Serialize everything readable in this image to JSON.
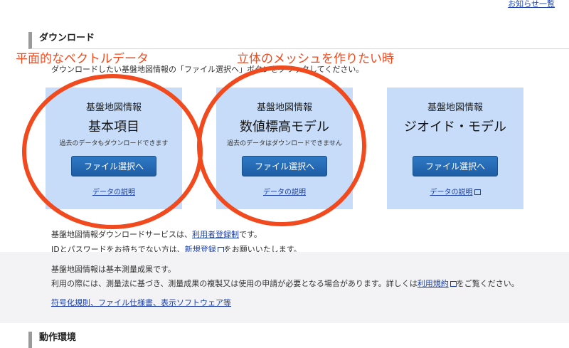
{
  "header": {
    "news_link": "お知らせ一覧"
  },
  "download_section": {
    "heading": "ダウンロード",
    "intro": "ダウンロードしたい基盤地図情報の「ファイル選択へ」ボタンをクリックしてください。"
  },
  "cards": [
    {
      "kind": "基盤地図情報",
      "title": "基本項目",
      "note": "過去のデータもダウンロードできます",
      "button": "ファイル選択へ",
      "doc_link": "データの説明"
    },
    {
      "kind": "基盤地図情報",
      "title": "数値標高モデル",
      "note": "過去のデータはダウンロードできません",
      "button": "ファイル選択へ",
      "doc_link": "データの説明"
    },
    {
      "kind": "基盤地図情報",
      "title": "ジオイド・モデル",
      "note": "",
      "button": "ファイル選択へ",
      "doc_link": "データの説明"
    }
  ],
  "service": {
    "line1_prefix": "基盤地図情報ダウンロードサービスは、",
    "line1_link": "利用者登録制",
    "line1_suffix": "です。",
    "line2_prefix": "IDとパスワードをお持ちでない方は、",
    "line2_link": "新規登録",
    "line2_suffix": "をお願いいたします。"
  },
  "survey": {
    "line1": "基盤地図情報は基本測量成果です。",
    "line2_prefix": "利用の際には、測量法に基づき、測量成果の複製又は使用の申請が必要となる場合があります。詳しくは",
    "line2_link": "利用規約",
    "line2_suffix": "をご覧ください。",
    "link3": "符号化規則、ファイル仕様書、表示ソフトウェア等"
  },
  "env_section": {
    "heading": "動作環境"
  },
  "annotations": {
    "left": "平面的なベクトルデータ",
    "right": "立体のメッシュを作りたい時",
    "color": "#f04a1e"
  }
}
